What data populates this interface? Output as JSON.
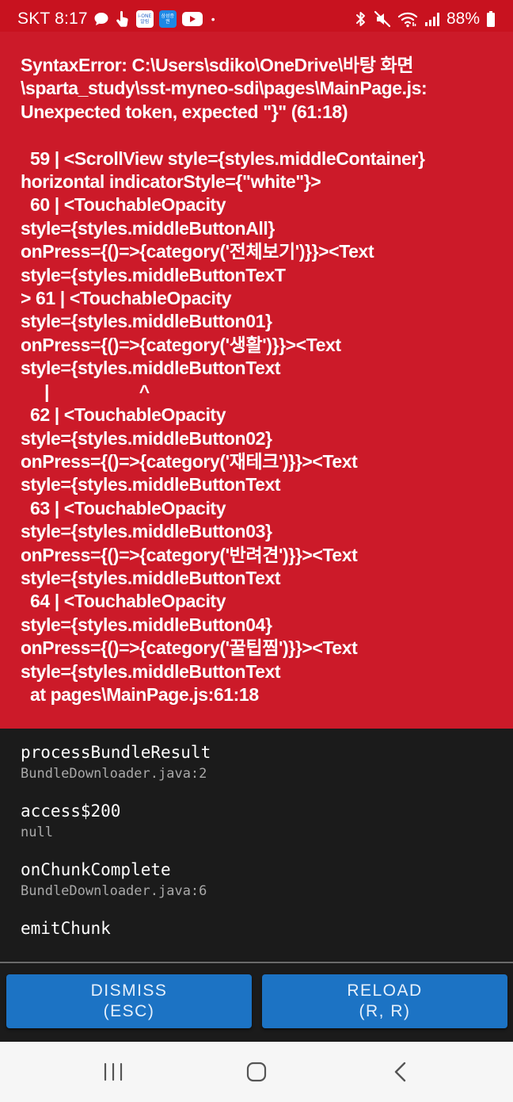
{
  "status_bar": {
    "carrier_time": "SKT 8:17",
    "battery": "88%",
    "icons": [
      "chat-bubble-icon",
      "hand-touch-icon",
      "ione-bank-app-icon",
      "samsung-securities-app-icon",
      "youtube-icon",
      "more-dot-icon",
      "bluetooth-icon",
      "mute-icon",
      "wifi-icon",
      "signal-icon",
      "battery-icon"
    ],
    "app_badge_1": "i-ONE\n알림",
    "app_badge_2": "삼성증권",
    "more_dot": "•"
  },
  "error": {
    "message": "SyntaxError: C:\\Users\\sdiko\\OneDrive\\바탕 화면\n\\sparta_study\\sst-myneo-sdi\\pages\\MainPage.js:\nUnexpected token, expected \"}\" (61:18)\n\n  59 | <ScrollView style={styles.middleContainer}\nhorizontal indicatorStyle={\"white\"}>\n  60 | <TouchableOpacity\nstyle={styles.middleButtonAll}\nonPress={()=>{category('전체보기')}}><Text\nstyle={styles.middleButtonTexT\n> 61 | <TouchableOpacity\nstyle={styles.middleButton01}\nonPress={()=>{category('생활')}}><Text\nstyle={styles.middleButtonText\n     |                   ^\n  62 | <TouchableOpacity\nstyle={styles.middleButton02}\nonPress={()=>{category('재테크')}}><Text\nstyle={styles.middleButtonText\n  63 | <TouchableOpacity\nstyle={styles.middleButton03}\nonPress={()=>{category('반려견')}}><Text\nstyle={styles.middleButtonText\n  64 | <TouchableOpacity\nstyle={styles.middleButton04}\nonPress={()=>{category('꿀팁찜')}}><Text\nstyle={styles.middleButtonText\n  at pages\\MainPage.js:61:18"
  },
  "stack_trace": [
    {
      "method": "processBundleResult",
      "file": "BundleDownloader.java:2"
    },
    {
      "method": "access$200",
      "file": "null"
    },
    {
      "method": "onChunkComplete",
      "file": "BundleDownloader.java:6"
    },
    {
      "method": "emitChunk",
      "file": ""
    }
  ],
  "buttons": {
    "dismiss_line1": "DISMISS",
    "dismiss_line2": "(ESC)",
    "reload_line1": "RELOAD",
    "reload_line2": "(R, R)"
  },
  "colors": {
    "error_red": "#cc1a29",
    "status_red": "#c8121f",
    "stack_bg": "#1b1b1b",
    "button_blue": "#1c73c4"
  },
  "nav_bar": {
    "icons": [
      "recent-apps-icon",
      "home-icon",
      "back-icon"
    ]
  }
}
